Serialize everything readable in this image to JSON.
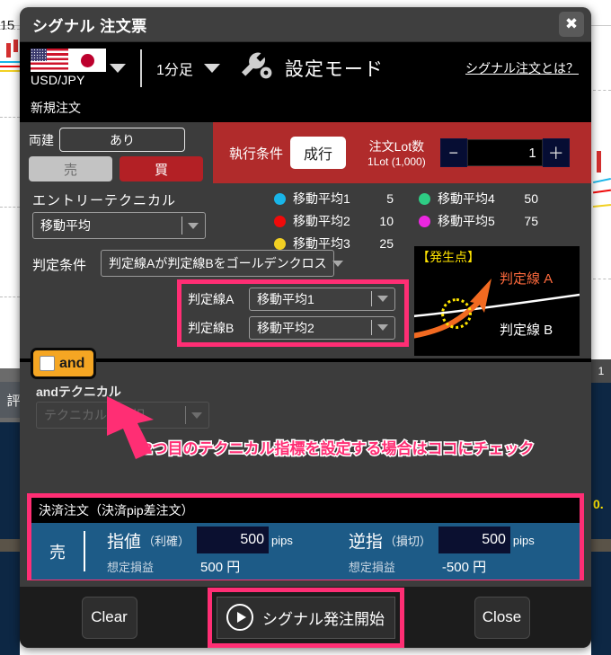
{
  "window": {
    "title": "シグナル 注文票",
    "close_icon": "close-icon"
  },
  "symbol_bar": {
    "pair": "USD/JPY",
    "pair_dropdown_icon": "chevron-down-icon",
    "timeframe": "1分足",
    "timeframe_dropdown_icon": "chevron-down-icon",
    "settings_icon": "wrench-gear-icon",
    "settings_label": "設定モード",
    "help_link": "シグナル注文とは？"
  },
  "new_order": {
    "header": "新規注文",
    "ryodate_label": "両建",
    "ryodate_value": "あり",
    "sell_label": "売",
    "buy_label": "買",
    "exec_label": "執行条件",
    "exec_value": "成行",
    "lot_title": "注文Lot数",
    "lot_sub": "1Lot (1,000)",
    "minus_label": "−",
    "plus_label": "＋",
    "lot_value": "1"
  },
  "technical": {
    "entry_label": "エントリーテクニカル",
    "entry_value": "移動平均",
    "condition_label": "判定条件",
    "condition_value": "判定線Aが判定線Bをゴールデンクロス",
    "ma_legend": [
      {
        "name": "移動平均1",
        "value": "5",
        "color": "#19b5e8"
      },
      {
        "name": "移動平均2",
        "value": "10",
        "color": "#f00a0a"
      },
      {
        "name": "移動平均3",
        "value": "25",
        "color": "#f2d023"
      },
      {
        "name": "移動平均4",
        "value": "50",
        "color": "#2ecc84"
      },
      {
        "name": "移動平均5",
        "value": "75",
        "color": "#ec27e0"
      }
    ],
    "line_a_label": "判定線A",
    "line_a_value": "移動平均1",
    "line_b_label": "判定線B",
    "line_b_value": "移動平均2",
    "diagram": {
      "title": "【発生点】",
      "label_a": "判定線 A",
      "label_b": "判定線 B"
    }
  },
  "and_section": {
    "chip_label": "and",
    "tech_label": "andテクニカル",
    "select_placeholder": "テクニカルの選択",
    "annotation": "2つ目のテクニカル指標を設定する場合はココにチェック"
  },
  "settlement": {
    "header": "決済注文（決済pip差注文）",
    "side": "売",
    "take_profit": {
      "name": "指値",
      "paren": "（利確）",
      "pips": "500",
      "unit": "pips",
      "est_label": "想定損益",
      "est_value": "500 円"
    },
    "stop_loss": {
      "name": "逆指",
      "paren": "（損切）",
      "pips": "500",
      "unit": "pips",
      "est_label": "想定損益",
      "est_value": "-500 円"
    }
  },
  "footer": {
    "clear_label": "Clear",
    "start_label": "シグナル発注開始",
    "start_icon": "play-circle-icon",
    "close_label": "Close"
  },
  "background": {
    "price_label": "15",
    "eval_label": "評",
    "rate_label": "0.",
    "tab_label": "1"
  },
  "colors": {
    "accent_pink": "#ff2e74",
    "buy_red": "#b32025",
    "panel_red": "#b02b2b",
    "settle_blue": "#1d5b87",
    "chip_orange": "#f5a623",
    "yellow": "#ffe400"
  }
}
